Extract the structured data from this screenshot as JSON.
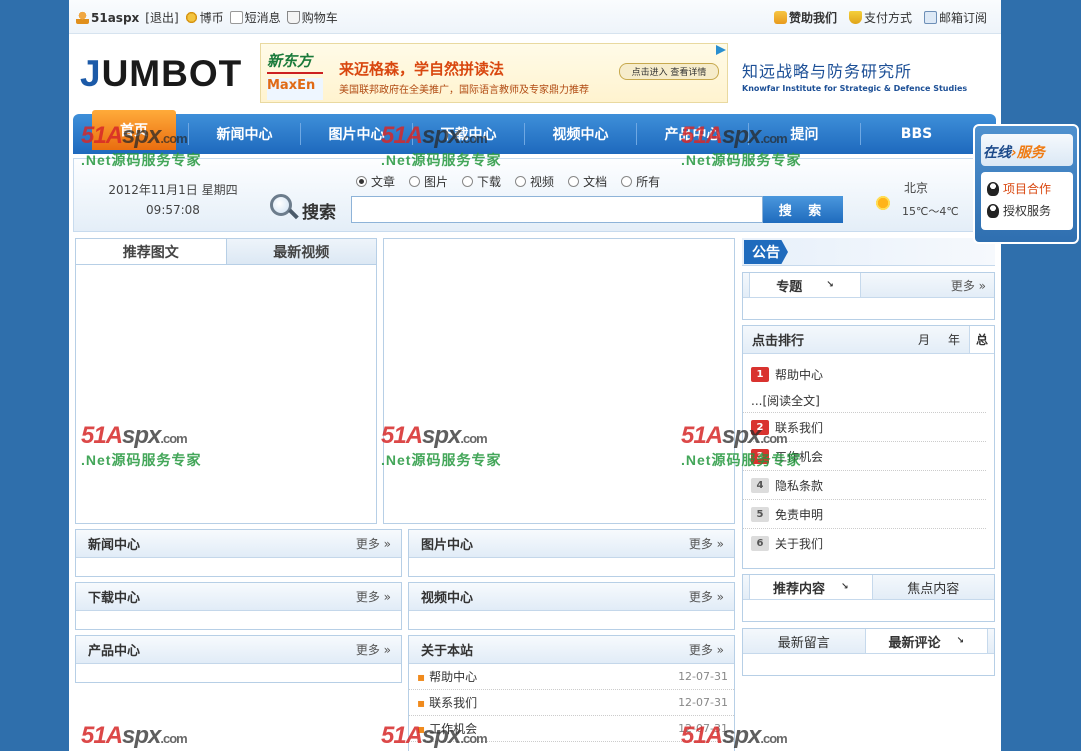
{
  "topbar": {
    "user": "51aspx",
    "logout": "[退出]",
    "coins": "博币",
    "messages": "短消息",
    "cart": "购物车",
    "sponsor": "赞助我们",
    "payment": "支付方式",
    "subscribe": "邮箱订阅"
  },
  "header": {
    "logo_j": "J",
    "logo_rest": "UMBOT",
    "banner": {
      "brand1": "新东方",
      "brand2": "MaxEn",
      "headline": "来迈格森，学自然拼读法",
      "subline": "美国联邦政府在全美推广，国际语言教师及专家鼎力推荐",
      "cta": "点击进入 查看详情"
    },
    "institute_cn": "知远战略与防务研究所",
    "institute_en": "Knowfar Institute for Strategic & Defence Studies"
  },
  "nav": {
    "items": [
      "首页",
      "新闻中心",
      "图片中心",
      "下载中心",
      "视频中心",
      "产品中心",
      "提问",
      "BBS"
    ]
  },
  "search": {
    "date": "2012年11月1日 星期四",
    "time": "09:57:08",
    "label": "搜索",
    "options": [
      "文章",
      "图片",
      "下载",
      "视频",
      "文档",
      "所有"
    ],
    "selected": "文章",
    "button": "搜 索",
    "city": "北京",
    "temp": "15℃～4℃"
  },
  "left_panel": {
    "tabs": [
      "推荐图文",
      "最新视频"
    ]
  },
  "notice": {
    "label": "公告"
  },
  "topics": {
    "tab": "专题",
    "more": "更多 »"
  },
  "rank": {
    "title": "点击排行",
    "periods": [
      "月",
      "年",
      "总"
    ],
    "items": [
      {
        "num": "1",
        "title": "帮助中心"
      },
      {
        "num": "2",
        "title": "联系我们"
      },
      {
        "num": "3",
        "title": "工作机会"
      },
      {
        "num": "4",
        "title": "隐私条款"
      },
      {
        "num": "5",
        "title": "免责申明"
      },
      {
        "num": "6",
        "title": "关于我们"
      }
    ],
    "read_more": "...[阅读全文]"
  },
  "recommend": {
    "tabs": [
      "推荐内容",
      "焦点内容"
    ]
  },
  "comments": {
    "tabs": [
      "最新留言",
      "最新评论"
    ]
  },
  "boxes": {
    "news": "新闻中心",
    "pictures": "图片中心",
    "downloads": "下载中心",
    "videos": "视频中心",
    "products": "产品中心",
    "about": "关于本站",
    "more": "更多 »"
  },
  "about_list": [
    {
      "title": "帮助中心",
      "date": "12-07-31"
    },
    {
      "title": "联系我们",
      "date": "12-07-31"
    },
    {
      "title": "工作机会",
      "date": "12-07-31"
    }
  ],
  "service": {
    "head_a": "在线",
    "head_b": "服务",
    "items": [
      "项目合作",
      "授权服务"
    ]
  },
  "watermark": {
    "brand_a": "51A",
    "brand_b": "spx",
    "domain": ".com",
    "slogan": ".Net源码服务专家"
  }
}
